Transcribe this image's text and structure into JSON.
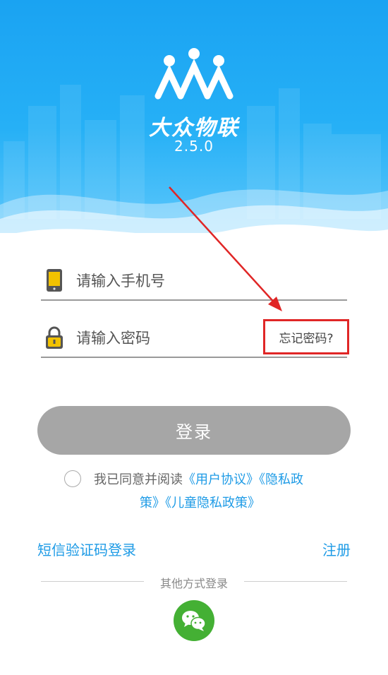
{
  "header": {
    "app_name": "大众物联",
    "version": "2.5.0",
    "logo_icon": "people-group-logo",
    "background_color": "#1aa3f2"
  },
  "form": {
    "phone_placeholder": "请输入手机号",
    "password_placeholder": "请输入密码",
    "forgot_password": "忘记密码?",
    "phone_icon": "phone-icon",
    "lock_icon": "lock-icon"
  },
  "login_button": {
    "label": "登录",
    "color": "#a6a6a6"
  },
  "agreement": {
    "prefix": "我已同意并阅读",
    "user_agreement": "《用户协议》",
    "privacy_policy_part1": "《隐私政",
    "privacy_policy_part2": "策》",
    "child_privacy": "《儿童隐私政策》",
    "checked": false
  },
  "links": {
    "sms_login": "短信验证码登录",
    "register": "注册",
    "link_color": "#1e9be6"
  },
  "other_login": {
    "label": "其他方式登录",
    "wechat_icon": "wechat-icon",
    "wechat_color": "#44b034"
  },
  "annotation": {
    "highlight_color": "#e02626"
  }
}
